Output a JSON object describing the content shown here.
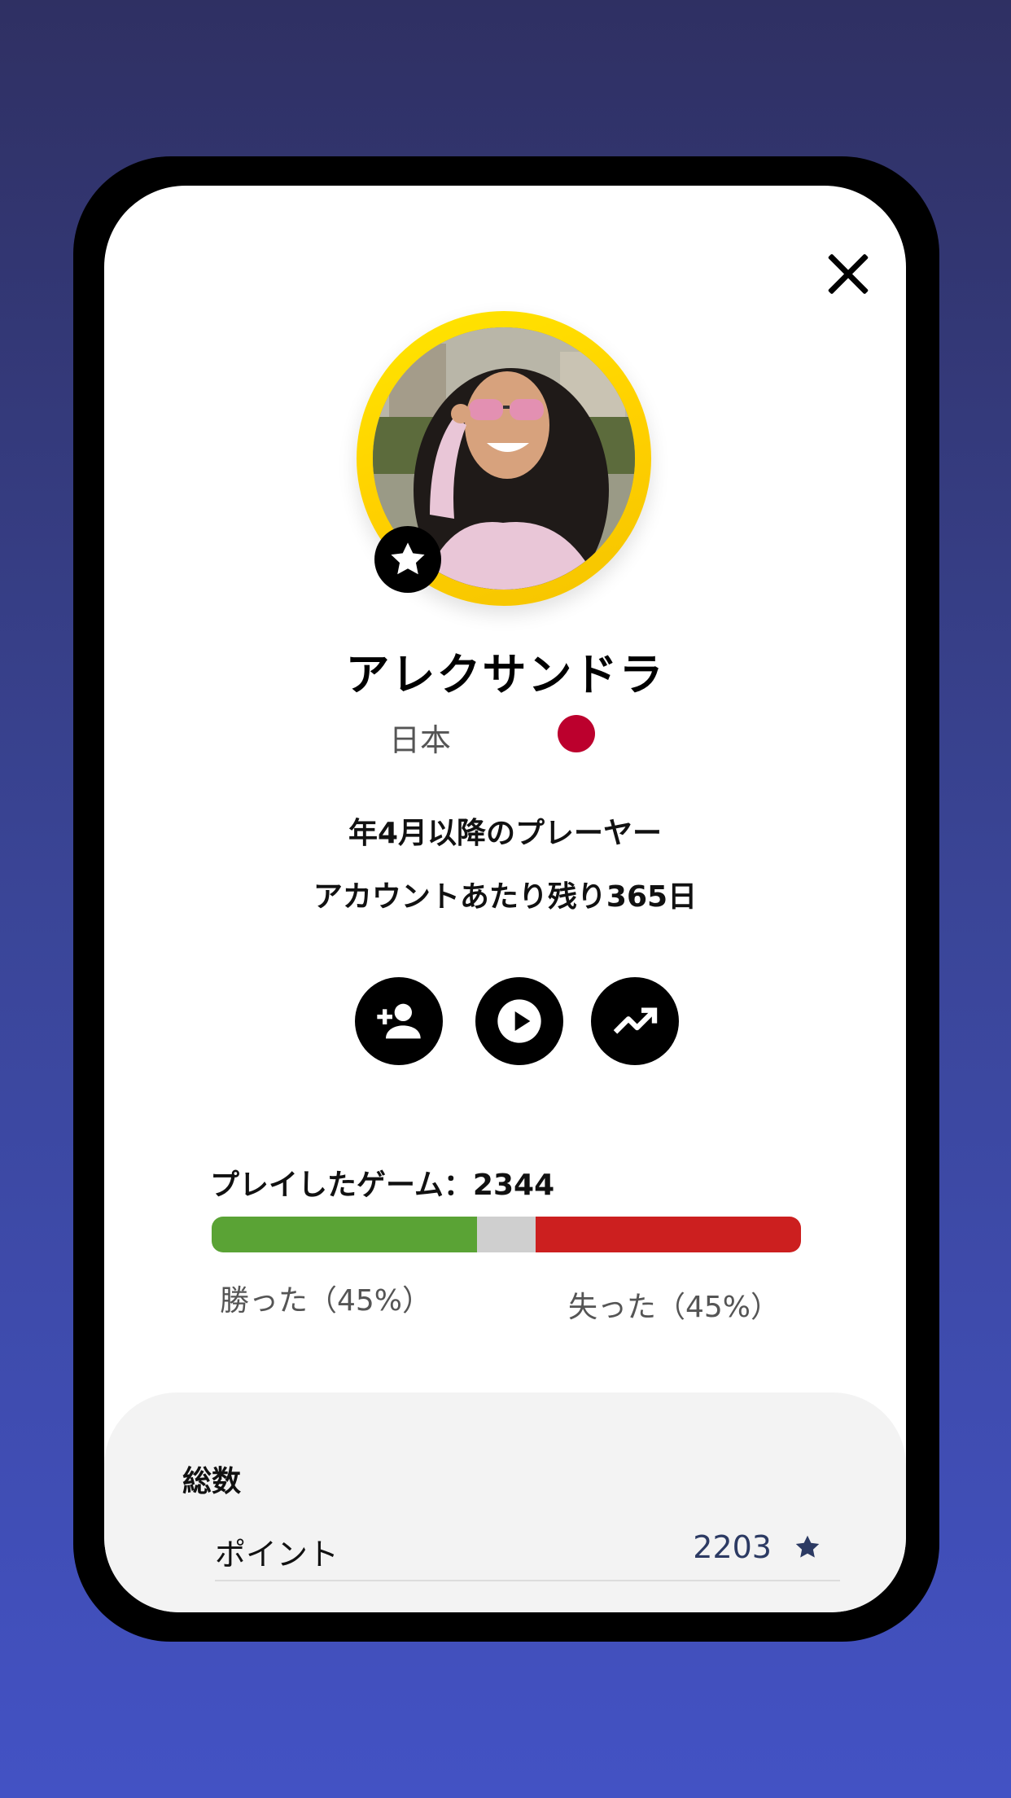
{
  "profile": {
    "name": "アレクサンドラ",
    "country": "日本",
    "flag_color": "#bc002d",
    "since": "年4月以降のプレーヤー",
    "remaining": "アカウントあたり残り365日"
  },
  "actions": [
    {
      "icon": "add-friend-icon"
    },
    {
      "icon": "play-icon"
    },
    {
      "icon": "trending-up-icon"
    }
  ],
  "games": {
    "label": "プレイしたゲーム：2344",
    "won_label": "勝った（45%）",
    "lost_label": "失った（45%）",
    "won_percent": 45,
    "draw_percent": 10,
    "lost_percent": 45,
    "colors": {
      "won": "#5aa335",
      "draw": "#cfcfcf",
      "lost": "#cc1f1f"
    }
  },
  "stats": {
    "title": "総数",
    "rows": [
      {
        "label": "ポイント",
        "value": "2203",
        "icon": "star-icon"
      },
      {
        "label": "",
        "value": ""
      }
    ]
  },
  "colors": {
    "ring": "#ffd400",
    "accent": "#2c3a63"
  }
}
